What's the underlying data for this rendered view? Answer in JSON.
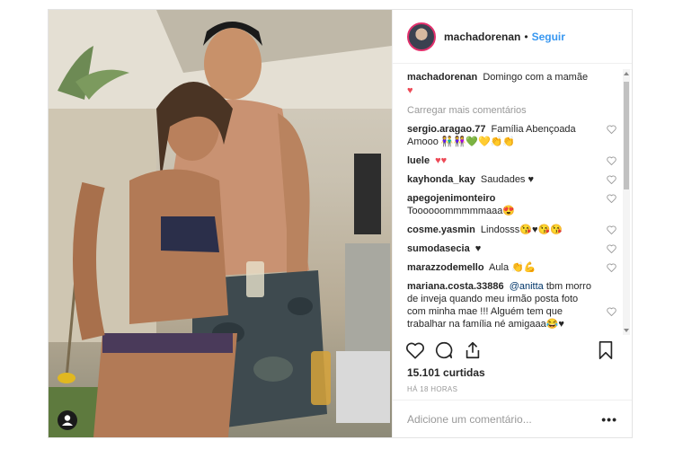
{
  "header": {
    "username": "machadorenan",
    "dot": "•",
    "follow": "Seguir"
  },
  "caption": {
    "username": "machadorenan",
    "text": "Domingo com a mamãe",
    "emoji": "♥"
  },
  "load_more": "Carregar mais comentários",
  "comments": [
    {
      "user": "sergio.aragao.77",
      "text": "Família Abençoada Amooo 👫👭💚💛👏👏"
    },
    {
      "user": "luele",
      "text": "♥♥"
    },
    {
      "user": "kayhonda_kay",
      "text": "Saudades ♥"
    },
    {
      "user": "apegojenimonteiro",
      "text": "Toooooommmmmaaa😍"
    },
    {
      "user": "cosme.yasmin",
      "text": "Lindosss😘♥😘😘"
    },
    {
      "user": "sumodasecia",
      "text": "♥"
    },
    {
      "user": "marazzodemello",
      "text": "Aula 👏💪"
    },
    {
      "user": "mariana.costa.33886",
      "mention": "@anitta",
      "text": "tbm morro de inveja quando meu irmão posta foto com minha mae !!! Alguém tem que trabalhar na família né amigaaa😂♥"
    }
  ],
  "likes": "15.101 curtidas",
  "timestamp": "HÁ 18 HORAS",
  "add_comment": {
    "placeholder": "Adicione um comentário...",
    "more": "•••"
  },
  "colors": {
    "accent": "#3897f0",
    "heart": "#ed4956",
    "border": "#efefef"
  }
}
